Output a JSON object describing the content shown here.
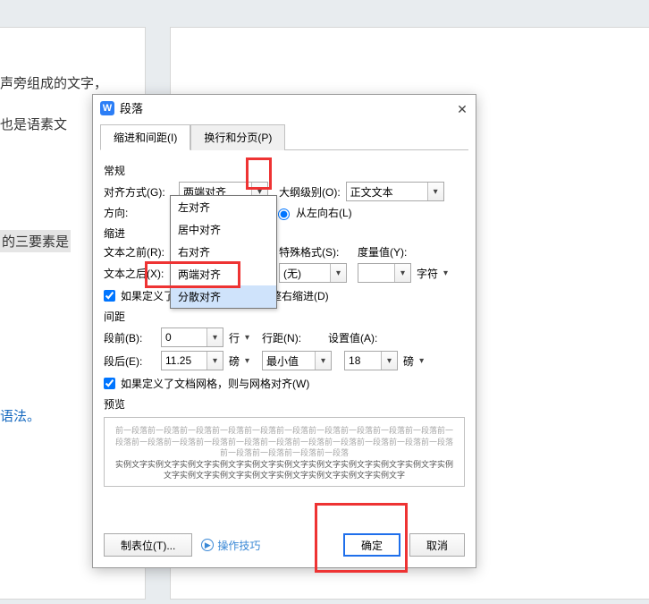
{
  "background": {
    "line1": "声旁组成的文字，",
    "line2": "也是语素文",
    "line3": "的三要素是",
    "line4": "语法。"
  },
  "dialog": {
    "title": "段落",
    "app_icon_letter": "W",
    "tabs": {
      "indent_spacing": "缩进和间距(I)",
      "line_page_break": "换行和分页(P)"
    },
    "general_section": "常规",
    "alignment_label": "对齐方式(G):",
    "alignment_value": "两端对齐",
    "alignment_options": [
      "左对齐",
      "居中对齐",
      "右对齐",
      "两端对齐",
      "分散对齐"
    ],
    "outline_label": "大纲级别(O):",
    "outline_value": "正文文本",
    "direction_label": "方向:",
    "direction_ltr": "从左向右(L)",
    "indent_section": "缩进",
    "text_before_label": "文本之前(R):",
    "text_after_label": "文本之后(X):",
    "special_format_label": "特殊格式(S):",
    "special_format_value": "(无)",
    "measure_label": "度量值(Y):",
    "measure_unit": "字符",
    "auto_adjust_checkbox": "如果定义了文档网格，则自动调整右缩进(D)",
    "spacing_section": "间距",
    "before_label": "段前(B):",
    "before_value": "0",
    "before_unit": "行",
    "after_label": "段后(E):",
    "after_value": "11.25",
    "after_unit": "磅",
    "line_spacing_label": "行距(N):",
    "line_spacing_value": "最小值",
    "set_value_label": "设置值(A):",
    "set_value_value": "18",
    "set_value_unit": "磅",
    "grid_align_checkbox": "如果定义了文档网格，则与网格对齐(W)",
    "preview_label": "预览",
    "preview_filler_gray": "前一段落前一段落前一段落前一段落前一段落前一段落前一段落前一段落前一段落前一段落前一段落前一段落前一段落前一段落前一段落前一段落前一段落前一段落前一段落前一段落前一段落前一段落前一段落前一段落前一段落",
    "preview_filler_sample": "实例文字实例文字实例文字实例文字实例文字实例文字实例文字实例文字实例文字实例文字实例文字实例文字实例文字实例文字实例文字实例文字实例文字实例文字",
    "tabstops_btn": "制表位(T)...",
    "help_link": "操作技巧",
    "ok_btn": "确定",
    "cancel_btn": "取消"
  }
}
